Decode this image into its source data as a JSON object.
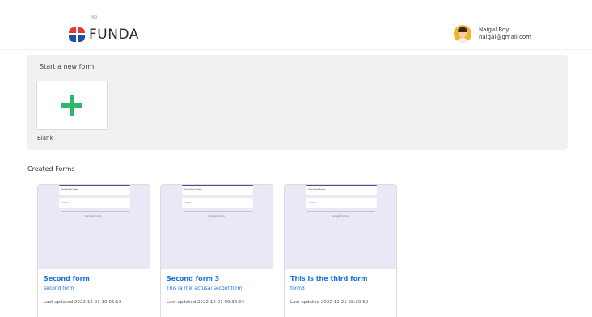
{
  "header": {
    "logo_text": "FUNDA",
    "logo_sub": "PRO",
    "user": {
      "name": "Naigal Roy",
      "email": "naigal@gmail.com"
    }
  },
  "new_form": {
    "title": "Start a new form",
    "blank_label": "Blank"
  },
  "created": {
    "title": "Created Forms",
    "forms": [
      {
        "thumb_title": "Untitled form",
        "thumb_field": "Option",
        "thumb_google": "Google Forms",
        "title": "Second form",
        "description": "second form",
        "updated": "Last updated 2022-12-21 10:06:13"
      },
      {
        "thumb_title": "Untitled form",
        "thumb_field": "Option",
        "thumb_google": "Google Forms",
        "title": "Second form 3",
        "description": "This ia rhw actusal seconf form",
        "updated": "Last updated 2022-12-21 00:34:04"
      },
      {
        "thumb_title": "Untitled form",
        "thumb_field": "Option",
        "thumb_google": "Google Forms",
        "title": "This is the third form",
        "description": "form3",
        "updated": "Last updated 2022-12-21 08:30:59"
      }
    ]
  },
  "colors": {
    "accent": "#1a73e8",
    "plus": "#2fb86c",
    "logo_red": "#e53935",
    "logo_blue": "#1e4fa3",
    "form_purple": "#673ab7"
  },
  "icons": {
    "logo": "funda-logo-icon",
    "plus": "plus-icon",
    "avatar": "avatar-icon"
  }
}
